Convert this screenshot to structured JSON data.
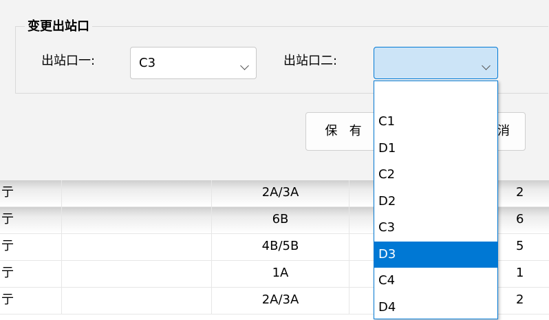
{
  "group": {
    "title": "变更出站口",
    "exit1_label": "出站口一:",
    "exit1_value": "C3",
    "exit2_label": "出站口二:",
    "exit2_value": ""
  },
  "buttons": {
    "save_label": "保",
    "save_label_partial": "有",
    "cancel_label": "消"
  },
  "dropdown": {
    "options": [
      "",
      "C1",
      "D1",
      "C2",
      "D2",
      "C3",
      "D3",
      "C4",
      "D4"
    ],
    "highlighted": "D3"
  },
  "table": {
    "rows": [
      {
        "c0": "亍",
        "c1": "",
        "c2": "2A/3A",
        "c3": "",
        "c4": "2",
        "selected": true
      },
      {
        "c0": "亍",
        "c1": "",
        "c2": "6B",
        "c3": "",
        "c4": "6",
        "selected": true
      },
      {
        "c0": "亍",
        "c1": "",
        "c2": "4B/5B",
        "c3": "",
        "c4": "5"
      },
      {
        "c0": "亍",
        "c1": "",
        "c2": "1A",
        "c3": "",
        "c4": "1"
      },
      {
        "c0": "亍",
        "c1": "",
        "c2": "2A/3A",
        "c3": "",
        "c4": "2"
      }
    ]
  },
  "colors": {
    "accent": "#0078d4",
    "active_combo_bg": "#cce4f7"
  }
}
